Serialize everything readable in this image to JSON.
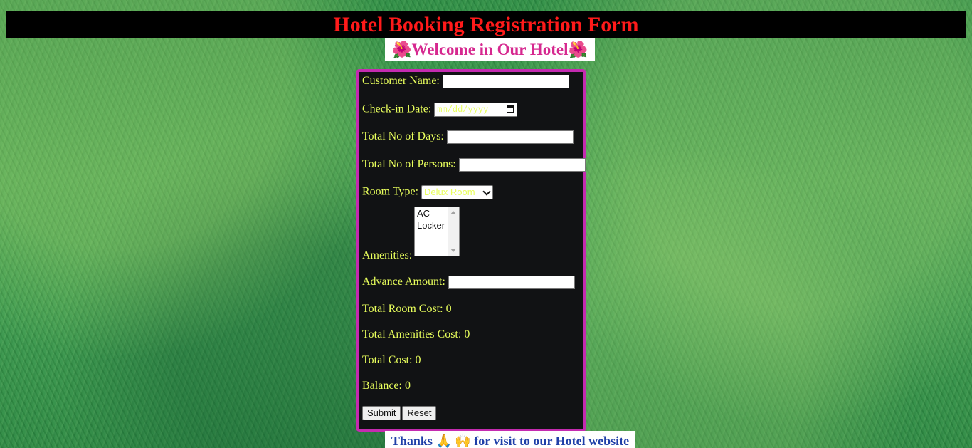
{
  "header": {
    "title": "Hotel Booking Registration Form"
  },
  "welcome": {
    "text": "Welcome in Our Hotel",
    "emoji_left": "🌺",
    "emoji_right": "🌺"
  },
  "form": {
    "customer_name": {
      "label": "Customer Name:",
      "value": ""
    },
    "checkin_date": {
      "label": "Check-in Date:",
      "placeholder": "mm/dd/yyyy"
    },
    "total_days": {
      "label": "Total No of Days:",
      "value": ""
    },
    "total_persons": {
      "label": "Total No of Persons:",
      "value": ""
    },
    "room_type": {
      "label": "Room Type:",
      "selected": "Delux Room"
    },
    "amenities": {
      "label": "Amenities:",
      "options": [
        "AC",
        "Locker"
      ]
    },
    "advance_amount": {
      "label": "Advance Amount:",
      "value": ""
    },
    "total_room_cost": {
      "label": "Total Room Cost:",
      "value": "0"
    },
    "total_amenities_cost": {
      "label": "Total Amenities Cost:",
      "value": "0"
    },
    "total_cost": {
      "label": "Total Cost:",
      "value": "0"
    },
    "balance": {
      "label": "Balance:",
      "value": "0"
    },
    "submit_label": "Submit",
    "reset_label": "Reset"
  },
  "footer": {
    "thanks": "Thanks",
    "emoji_1": "🙏",
    "emoji_2": "🙌",
    "text": "for visit to our Hotel website"
  },
  "colors": {
    "title": "#ff1a1a",
    "title_bg": "#000000",
    "welcome": "#d6288f",
    "form_border": "#c42bb0",
    "form_bg": "#111214",
    "form_text": "#e9ff5c",
    "footer_text": "#1f3fa8"
  }
}
